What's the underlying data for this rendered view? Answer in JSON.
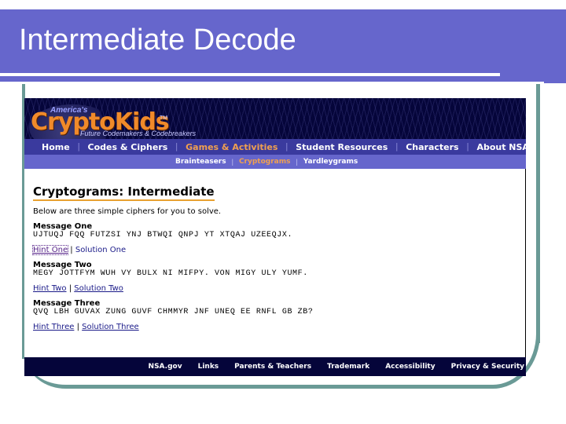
{
  "slide": {
    "title": "Intermediate Decode",
    "colors": {
      "title_band": "#6666cc",
      "frame": "#6a9a96"
    }
  },
  "site": {
    "logo": {
      "kicker": "America's",
      "name": "CryptoKids",
      "trademark": "TM",
      "tagline": "Future Codemakers & Codebreakers"
    },
    "nav": [
      {
        "label": "Home",
        "active": false
      },
      {
        "label": "Codes & Ciphers",
        "active": false
      },
      {
        "label": "Games & Activities",
        "active": true
      },
      {
        "label": "Student Resources",
        "active": false
      },
      {
        "label": "Characters",
        "active": false
      },
      {
        "label": "About NSA",
        "active": false
      }
    ],
    "subnav": [
      {
        "label": "Brainteasers",
        "active": false
      },
      {
        "label": "Cryptograms",
        "active": true
      },
      {
        "label": "Yardleygrams",
        "active": false
      }
    ],
    "separator": "|",
    "colors": {
      "banner": "#05053a",
      "nav": "#3a3a9e",
      "subnav": "#6666cc",
      "active": "#f0a050",
      "heading_underline": "#e8a030"
    }
  },
  "page": {
    "heading": "Cryptograms: Intermediate",
    "intro": "Below are three simple ciphers for you to solve.",
    "messages": [
      {
        "title": "Message One",
        "cipher": "UJTUQJ FQQ FUTZSI YNJ BTWQI QNPJ YT XTQAJ UZEEQJX.",
        "hint": "Hint One",
        "solution": "Solution One"
      },
      {
        "title": "Message Two",
        "cipher": "MEGY JOTTFYM WUH VY BULX NI MIFPY. VON MIGY ULY YUMF.",
        "hint": "Hint Two",
        "solution": "Solution Two"
      },
      {
        "title": "Message Three",
        "cipher": "QVQ LBH GUVAX ZUNG GUVF CHMMYR JNF UNEQ EE RNFL GB ZB?",
        "hint": "Hint Three",
        "solution": "Solution Three"
      }
    ]
  },
  "footer": {
    "links": [
      "NSA.gov",
      "Links",
      "Parents & Teachers",
      "Trademark",
      "Accessibility",
      "Privacy & Security"
    ]
  }
}
